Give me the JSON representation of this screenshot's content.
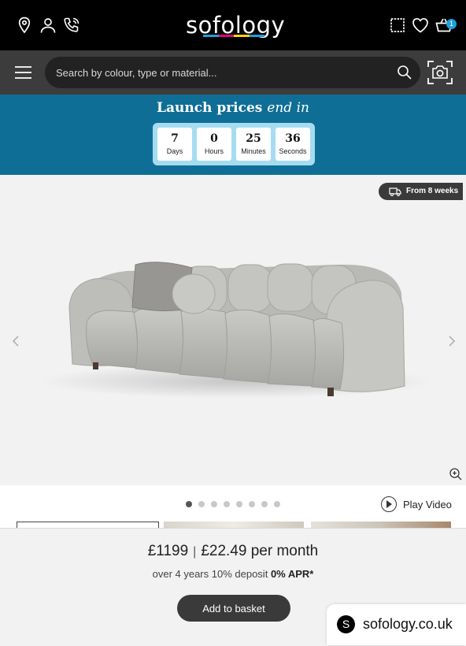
{
  "header": {
    "logo_text": "sofology",
    "logo_bar_colors": [
      "#1ea0dc",
      "#e6007e",
      "#ffd200",
      "#1ea0dc"
    ],
    "icons": [
      "location-pin-icon",
      "account-icon",
      "phone-icon",
      "fabric-swatch-icon",
      "heart-icon",
      "basket-icon"
    ],
    "basket_count": "1"
  },
  "search": {
    "placeholder": "Search by colour, type or material...",
    "icons": [
      "menu-icon",
      "search-icon",
      "camera-search-icon"
    ]
  },
  "launch": {
    "title": "Launch prices",
    "title_italic": "end in",
    "countdown": [
      {
        "value": "7",
        "unit": "Days"
      },
      {
        "value": "0",
        "unit": "Hours"
      },
      {
        "value": "25",
        "unit": "Minutes"
      },
      {
        "value": "36",
        "unit": "Seconds"
      }
    ],
    "colors": {
      "banner": "#0f6e96",
      "countdown_frame": "#a6dcf2"
    }
  },
  "gallery": {
    "delivery": "From 8 weeks",
    "current_slide": 1,
    "slide_count": 8,
    "play_video": "Play Video"
  },
  "purchase": {
    "price": "£1199",
    "monthly": "£22.49 per month",
    "finance_terms": "over 4 years 10% deposit",
    "apr": "0% APR*",
    "add_to_basket": "Add to basket"
  },
  "site_tag": {
    "letter": "S",
    "domain": "sofology.co.uk"
  }
}
